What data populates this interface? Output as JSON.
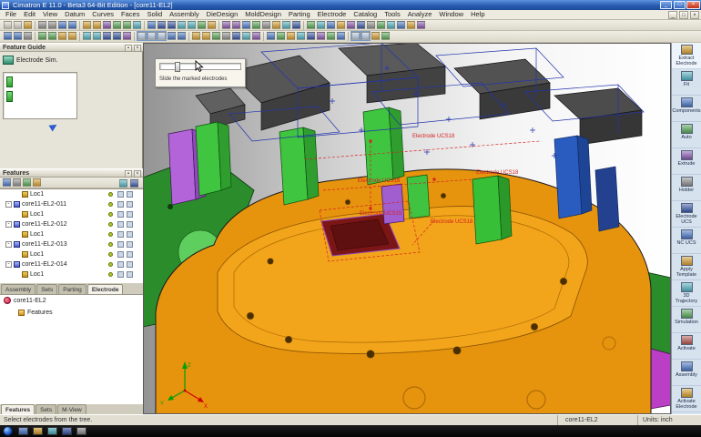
{
  "window": {
    "title": "Cimatron E 11.0 - Beta3 64-Bit Edition - [core11-EL2]"
  },
  "menu": {
    "items": [
      "File",
      "Edit",
      "View",
      "Datum",
      "Curves",
      "Faces",
      "Solid",
      "Assembly",
      "DieDesign",
      "MoldDesign",
      "Parting",
      "Electrode",
      "Catalog",
      "Tools",
      "Analyze",
      "Window",
      "Help"
    ]
  },
  "feature_guide": {
    "title": "Feature Guide",
    "item": "Electrode Sim."
  },
  "features_panel": {
    "title": "Features",
    "tree": [
      {
        "label": "Loc1"
      },
      {
        "label": "core11-EL2-011"
      },
      {
        "label": "Loc1"
      },
      {
        "label": "core11-EL2-012"
      },
      {
        "label": "Loc1"
      },
      {
        "label": "core11-EL2-013"
      },
      {
        "label": "Loc1"
      },
      {
        "label": "core11-EL2-014"
      },
      {
        "label": "Loc1"
      }
    ],
    "tabs": [
      "Assembly",
      "Sets",
      "Parting",
      "Electrode"
    ]
  },
  "assembly_tree": {
    "root": "core11-EL2",
    "child": "Features",
    "tabs": [
      "Features",
      "Sets",
      "M-View"
    ]
  },
  "viewport": {
    "tooltip": "Slide the marked electrodes",
    "labels": [
      "Electrode UCS18",
      "Electrode UCS18",
      "Electrode UCS15",
      "Electrode UCS18",
      "Electrode UCS18"
    ],
    "axis": {
      "x": "X",
      "y": "Y",
      "z": "Z"
    }
  },
  "right_panel": {
    "items": [
      "Extract Electrode",
      "Fit",
      "Components",
      "Auto",
      "Extrude",
      "Holder",
      "Electrode UCS",
      "NC UCS",
      "Apply Template",
      "3D Trajectory",
      "Simulation",
      "Activate",
      "Assembly",
      "Activate Electrode"
    ]
  },
  "status_bar": {
    "message": "Select electrodes from the tree.",
    "document": "core11-EL2",
    "units": "Units: inch"
  },
  "colors": {
    "mold_orange": "#e6930e",
    "plate_green": "#2a8c2a",
    "electrode_green": "#3fc53f",
    "electrode_purple": "#b264d8",
    "annotation_red": "#d42222",
    "wireframe_blue": "#2334ad"
  }
}
